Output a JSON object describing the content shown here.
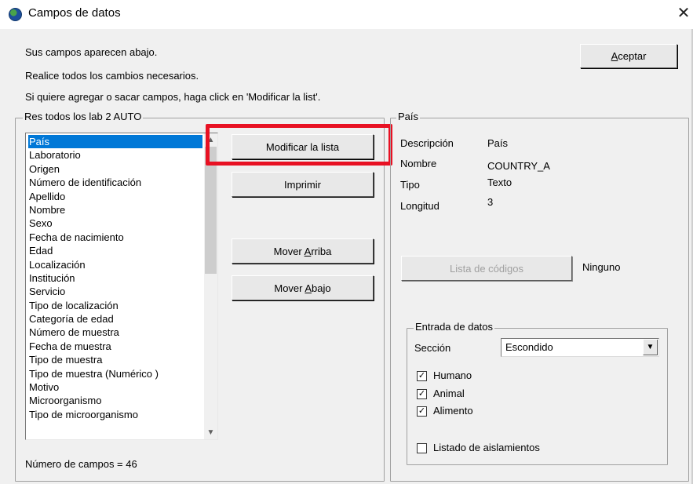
{
  "window": {
    "title": "Campos de datos",
    "close_glyph": "✕"
  },
  "intro": {
    "line1": "Sus campos aparecen abajo.",
    "line2": "Realice todos los cambios necesarios.",
    "line3": "Si quiere agregar o sacar campos, haga click en 'Modificar la list'."
  },
  "buttons": {
    "accept_accel": "A",
    "accept_rest": "ceptar",
    "modify_list": "Modificar la lista",
    "print": "Imprimir",
    "move_up_pre": "Mover ",
    "move_up_accel": "A",
    "move_up_rest": "rriba",
    "move_down_pre": "Mover ",
    "move_down_accel": "A",
    "move_down_rest": "bajo",
    "code_list": "Lista de códigos"
  },
  "fields_group": {
    "title": "Res todos los lab 2 AUTO",
    "items": [
      "País",
      "Laboratorio",
      "Origen",
      "Número de identificación",
      "Apellido",
      "Nombre",
      "Sexo",
      "Fecha de nacimiento",
      "Edad",
      "Localización",
      "Institución",
      "Servicio",
      "Tipo de localización",
      "Categoría de edad",
      "Número de muestra",
      "Fecha de muestra",
      "Tipo de muestra",
      "Tipo de muestra (Numérico )",
      "Motivo",
      "Microorganismo",
      "Tipo de microorganismo"
    ],
    "selected_index": 0,
    "count_text": "Número de campos = 46"
  },
  "field_details": {
    "title": "País",
    "description_label": "Descripción",
    "description_value": "País",
    "name_label": "Nombre",
    "name_value": "COUNTRY_A",
    "type_label": "Tipo",
    "type_value": "Texto",
    "length_label": "Longitud",
    "length_value": "3",
    "code_list_value": "Ninguno"
  },
  "data_entry": {
    "title": "Entrada de datos",
    "section_label": "Sección",
    "section_value": "Escondido",
    "checkboxes": [
      {
        "label": "Humano",
        "checked": true
      },
      {
        "label": "Animal",
        "checked": true
      },
      {
        "label": "Alimento",
        "checked": true
      },
      {
        "label": "Listado de aislamientos",
        "checked": false
      }
    ]
  },
  "colors": {
    "selection": "#0078d7",
    "highlight_frame": "#e81123"
  },
  "icons": {
    "app": "globe-icon",
    "close": "close-icon",
    "scroll_up": "chevron-up-icon",
    "scroll_down": "chevron-down-icon",
    "dropdown": "chevron-down-icon"
  }
}
